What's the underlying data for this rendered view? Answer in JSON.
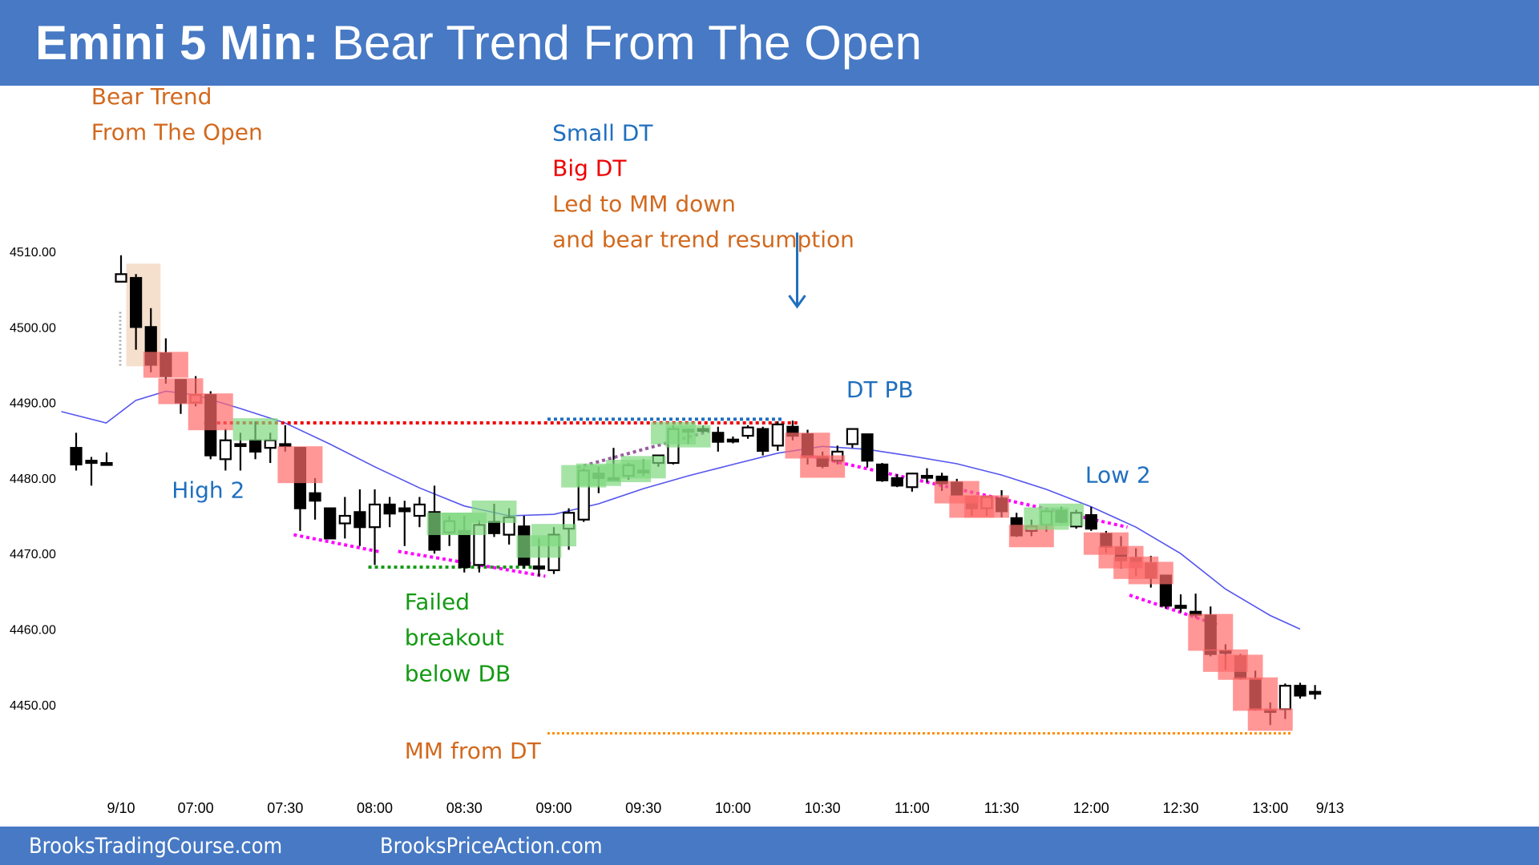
{
  "header": {
    "title_bold": "Emini 5 Min:",
    "title_rest": " Bear Trend From The Open"
  },
  "footer": {
    "left": "BrooksTradingCourse.com",
    "right": "BrooksPriceAction.com"
  },
  "colors": {
    "banner": "#4779C4",
    "bull_zone": "#7FD97F",
    "bear_zone": "#FF6B6B",
    "ema": "#5555EE",
    "orange": "#D2691E",
    "blue": "#1F6FBF",
    "red": "#EE0000",
    "green": "#139A13",
    "magenta": "#FF00FF"
  },
  "chart_data": {
    "type": "candlestick",
    "title": "Emini 5 Min: Bear Trend From The Open",
    "ylim": [
      4443,
      4515
    ],
    "yticks": [
      "4510.00",
      "4500.00",
      "4490.00",
      "4480.00",
      "4470.00",
      "4460.00",
      "4450.00"
    ],
    "ytick_values": [
      4510,
      4500,
      4490,
      4480,
      4470,
      4460,
      4450
    ],
    "xticks": [
      {
        "label": "9/10",
        "bar": 0
      },
      {
        "label": "07:00",
        "bar": 5
      },
      {
        "label": "07:30",
        "bar": 11
      },
      {
        "label": "08:00",
        "bar": 17
      },
      {
        "label": "08:30",
        "bar": 23
      },
      {
        "label": "09:00",
        "bar": 29
      },
      {
        "label": "09:30",
        "bar": 35
      },
      {
        "label": "10:00",
        "bar": 41
      },
      {
        "label": "10:30",
        "bar": 47
      },
      {
        "label": "11:00",
        "bar": 53
      },
      {
        "label": "11:30",
        "bar": 59
      },
      {
        "label": "12:00",
        "bar": 65
      },
      {
        "label": "12:30",
        "bar": 71
      },
      {
        "label": "13:00",
        "bar": 77
      },
      {
        "label": "9/13",
        "bar": 81
      }
    ],
    "prior_bars": [
      [
        4484,
        4486,
        4481,
        4481.8
      ],
      [
        4482.3,
        4482.8,
        4479,
        4482
      ],
      [
        4482,
        4483.4,
        4481.8,
        4481.8
      ]
    ],
    "bars_ohlc": [
      [
        4506,
        4509.5,
        4506,
        4507
      ],
      [
        4506.5,
        4507,
        4497,
        4500
      ],
      [
        4500,
        4502.5,
        4494,
        4495
      ],
      [
        4496.5,
        4498.5,
        4492.5,
        4493.5
      ],
      [
        4493,
        4493,
        4488.5,
        4490
      ],
      [
        4490,
        4493.5,
        4489.5,
        4491
      ],
      [
        4491,
        4491.5,
        4482.5,
        4483
      ],
      [
        4482.5,
        4486.5,
        4481,
        4485
      ],
      [
        4484.5,
        4486,
        4481,
        4484.5
      ],
      [
        4485,
        4487.5,
        4482.5,
        4483.5
      ],
      [
        4484,
        4486,
        4482,
        4485
      ],
      [
        4484.5,
        4487,
        4483.5,
        4484.3
      ],
      [
        4484,
        4484,
        4473,
        4476
      ],
      [
        4478,
        4480,
        4474.5,
        4477
      ],
      [
        4476,
        4476,
        4472.5,
        4472
      ],
      [
        4474,
        4477.5,
        4472,
        4475
      ],
      [
        4475.5,
        4478.5,
        4471,
        4473.5
      ],
      [
        4473.5,
        4478.5,
        4468.5,
        4476.5
      ],
      [
        4476.5,
        4477.5,
        4473.5,
        4475.3
      ],
      [
        4476,
        4477,
        4471,
        4475.6
      ],
      [
        4475,
        4477.5,
        4473.5,
        4476.5
      ],
      [
        4475.5,
        4479,
        4470,
        4470.5
      ],
      [
        4472.8,
        4475,
        4471,
        4474.3
      ],
      [
        4473,
        4475,
        4467.5,
        4468.2
      ],
      [
        4468.5,
        4474.4,
        4467.5,
        4473.8
      ],
      [
        4474.2,
        4476.6,
        4472.2,
        4472.7
      ],
      [
        4472.5,
        4476,
        4471.2,
        4474.8
      ],
      [
        4473.6,
        4475,
        4468,
        4468.5
      ],
      [
        4468.3,
        4472,
        4467,
        4468
      ],
      [
        4467.8,
        4473.5,
        4467.3,
        4472.5
      ],
      [
        4473.3,
        4476,
        4470.5,
        4475.4
      ],
      [
        4474.5,
        4481.3,
        4474.2,
        4481
      ],
      [
        4480.6,
        4481.5,
        4478,
        4480
      ],
      [
        4480,
        4484,
        4479.7,
        4479.8
      ],
      [
        4480.3,
        4482,
        4479.8,
        4481.7
      ],
      [
        4481,
        4482.5,
        4480.3,
        4481
      ],
      [
        4482,
        4483,
        4481.5,
        4483
      ],
      [
        4482,
        4487,
        4481.8,
        4486.5
      ],
      [
        4486.4,
        4486.6,
        4484.5,
        4486.3
      ],
      [
        4486.5,
        4487,
        4486,
        4486.4
      ],
      [
        4486,
        4486.8,
        4483.5,
        4484.8
      ],
      [
        4485.1,
        4485.5,
        4484.6,
        4485
      ],
      [
        4485.6,
        4487,
        4485.2,
        4486.7
      ],
      [
        4486.5,
        4486.8,
        4483,
        4483.6
      ],
      [
        4484.3,
        4487.5,
        4483.6,
        4487.1
      ],
      [
        4486.8,
        4487.6,
        4485,
        4485.6
      ],
      [
        4485.8,
        4486.4,
        4481.8,
        4482.8
      ],
      [
        4482.8,
        4483.5,
        4481.3,
        4481.6
      ],
      [
        4482.3,
        4484.3,
        4481.8,
        4483.5
      ],
      [
        4484.5,
        4486.6,
        4484,
        4486.5
      ],
      [
        4485.8,
        4485.8,
        4481.4,
        4482.3
      ],
      [
        4481.8,
        4482,
        4479.5,
        4479.7
      ],
      [
        4480,
        4480.5,
        4478.8,
        4479
      ],
      [
        4478.8,
        4480.7,
        4478.2,
        4480.6
      ],
      [
        4480.3,
        4481.3,
        4479.4,
        4480.2
      ],
      [
        4480.2,
        4480.7,
        4478.3,
        4479.3
      ],
      [
        4479.4,
        4479.9,
        4477.7,
        4477.8
      ],
      [
        4477.5,
        4477.7,
        4475,
        4476
      ],
      [
        4476,
        4477.7,
        4475,
        4477.5
      ],
      [
        4477.3,
        4478.4,
        4474.8,
        4475.6
      ],
      [
        4474.7,
        4475.4,
        4472.2,
        4472.4
      ],
      [
        4473,
        4474.5,
        4472.3,
        4473.6
      ],
      [
        4473.8,
        4475.7,
        4472.9,
        4475.6
      ],
      [
        4475.7,
        4476.2,
        4474,
        4474.2
      ],
      [
        4473.6,
        4475.8,
        4473.3,
        4475.4
      ],
      [
        4475.1,
        4476.2,
        4473,
        4473.3
      ],
      [
        4472.6,
        4473,
        4470.1,
        4470.9
      ],
      [
        4470.8,
        4472.3,
        4468,
        4469.1
      ],
      [
        4469.4,
        4470.7,
        4467,
        4468.2
      ],
      [
        4468.7,
        4469.7,
        4465.5,
        4466.8
      ],
      [
        4467.1,
        4467.1,
        4462.7,
        4463.1
      ],
      [
        4463.1,
        4464.6,
        4462.2,
        4462.8
      ],
      [
        4462.3,
        4464.7,
        4461.5,
        4461.9
      ],
      [
        4461.8,
        4463,
        4456.4,
        4456.7
      ],
      [
        4457.1,
        4458,
        4454.6,
        4457
      ],
      [
        4456.4,
        4456.7,
        4453.3,
        4453.5
      ],
      [
        4453.4,
        4454.5,
        4449.2,
        4449.4
      ],
      [
        4449.3,
        4450.3,
        4447.3,
        4449.2
      ],
      [
        4449.4,
        4452.8,
        4448.1,
        4452.5
      ],
      [
        4452.5,
        4452.9,
        4450.8,
        4451.2
      ],
      [
        4451.7,
        4452.6,
        4450.7,
        4451.7
      ]
    ],
    "ema": {
      "bars": [
        -4,
        -1,
        1,
        3,
        5,
        8,
        11,
        14,
        17,
        20,
        23,
        26,
        29,
        32,
        35,
        38,
        41,
        44,
        47,
        50,
        53,
        56,
        59,
        62,
        65,
        68,
        71,
        74,
        77,
        79
      ],
      "values": [
        4488.8,
        4487.3,
        4490.3,
        4491.5,
        4491,
        4489.2,
        4487.3,
        4484.5,
        4481.5,
        4478.7,
        4476.3,
        4475,
        4475.2,
        4476.6,
        4478.6,
        4480.3,
        4481.8,
        4483.3,
        4484.2,
        4483.8,
        4482.9,
        4481.9,
        4480.4,
        4478.5,
        4476.2,
        4473.5,
        4470,
        4465.3,
        4461.8,
        4460
      ]
    },
    "highlights": {
      "open_zone": {
        "bars": [
          1,
          2
        ],
        "top": 4508.4,
        "bottom": 4494.8
      },
      "bear_signal_bars": [
        3,
        4,
        6,
        12,
        46,
        47,
        56,
        57,
        58,
        61,
        66,
        67,
        68,
        69,
        73,
        74,
        75,
        76,
        77
      ],
      "bull_signal_bars": [
        9,
        22,
        23,
        25,
        28,
        29,
        31,
        32,
        34,
        35,
        37,
        38,
        62,
        63
      ],
      "open_gap_marker_bar": 0
    },
    "lines": [
      {
        "name": "big-dt-line",
        "color": "#EE0000",
        "from_bar": 6,
        "to_bar": 45,
        "price": 4487.3
      },
      {
        "name": "small-dt-line",
        "color": "#1F6FBF",
        "from_bar": 29,
        "to_bar": 44,
        "price": 4487.8
      },
      {
        "name": "db-line",
        "color": "#139A13",
        "from_bar": 17,
        "to_bar": 28,
        "price": 4468.2
      },
      {
        "name": "mm-line",
        "color": "#FF8C00",
        "from_bar": 29,
        "to_bar": 78,
        "price": 4446.2
      },
      {
        "name": "wedge-low-1",
        "color": "#FF00FF",
        "from_bar": 12,
        "from_price": 4472.5,
        "to_bar": 17,
        "to_price": 4470.2
      },
      {
        "name": "wedge-low-2",
        "color": "#FF00FF",
        "from_bar": 19,
        "from_price": 4470.3,
        "to_bar": 28,
        "to_price": 4467
      },
      {
        "name": "bull-channel",
        "color": "#9A5AA0",
        "from_bar": 31,
        "from_price": 4481.4,
        "to_bar": 39,
        "to_price": 4486.2
      },
      {
        "name": "bear-channel-1",
        "color": "#FF00FF",
        "from_bar": 46,
        "from_price": 4483.2,
        "to_bar": 67,
        "to_price": 4473.5
      },
      {
        "name": "bear-channel-2",
        "color": "#FF00FF",
        "from_bar": 68,
        "from_price": 4464.5,
        "to_bar": 73,
        "to_price": 4460.6
      }
    ],
    "annotations": [
      {
        "text": "Bear Trend",
        "color": "#D2691E",
        "bar": -2,
        "price": 4529.5
      },
      {
        "text": "From The Open",
        "color": "#D2691E",
        "bar": -2,
        "price": 4524.8
      },
      {
        "text": "Small DT",
        "color": "#1F6FBF",
        "bar": 28.9,
        "price": 4524.7
      },
      {
        "text": "Big DT",
        "color": "#EE0000",
        "bar": 28.9,
        "price": 4520
      },
      {
        "text": "Led to MM down",
        "color": "#D2691E",
        "bar": 28.9,
        "price": 4515.3
      },
      {
        "text": "and bear trend resumption",
        "color": "#D2691E",
        "bar": 28.9,
        "price": 4510.6
      },
      {
        "text": "DT PB",
        "color": "#1F6FBF",
        "bar": 48.6,
        "price": 4490.7
      },
      {
        "text": "High 2",
        "color": "#1F6FBF",
        "bar": 3.4,
        "price": 4477.4
      },
      {
        "text": "Low 2",
        "color": "#1F6FBF",
        "bar": 64.6,
        "price": 4479.4
      },
      {
        "text": "Failed",
        "color": "#139A13",
        "bar": 19,
        "price": 4462.6
      },
      {
        "text": "breakout",
        "color": "#139A13",
        "bar": 19,
        "price": 4457.9
      },
      {
        "text": "below DB",
        "color": "#139A13",
        "bar": 19,
        "price": 4453.1
      },
      {
        "text": "MM from DT",
        "color": "#D2691E",
        "bar": 19,
        "price": 4442.9
      }
    ],
    "arrow": {
      "bar": 45.3,
      "from_price": 4512.5,
      "to_price": 4502.7,
      "color": "#1F6FBF"
    }
  }
}
